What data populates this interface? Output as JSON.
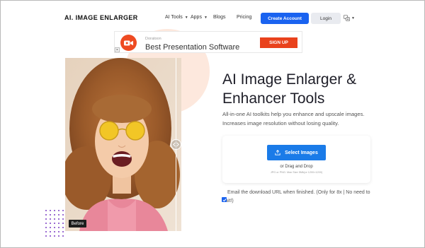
{
  "header": {
    "brand": "AI. IMAGE ENLARGER",
    "nav": [
      {
        "label": "AI Tools",
        "has_dropdown": true
      },
      {
        "label": "Apps",
        "has_dropdown": true
      },
      {
        "label": "Blogs",
        "has_dropdown": false
      },
      {
        "label": "Pricing",
        "has_dropdown": false
      }
    ],
    "create_account": "Create Account",
    "login": "Login",
    "language_icon": "translate-icon"
  },
  "ad": {
    "sponsor": "Doratoon",
    "title": "Best Presentation Software",
    "cta": "SIGN UP",
    "logo_icon": "video-camera-icon"
  },
  "preview": {
    "before_label": "Before",
    "handle_icon": "compare-arrows-icon"
  },
  "hero": {
    "title_line1": "AI Image Enlarger &",
    "title_line2": "Enhancer Tools",
    "description": "All-in-one AI toolkits help you enhance and upscale images. Increases image resolution without losing quality."
  },
  "upload": {
    "button": "Select Images",
    "button_icon": "upload-icon",
    "drag_text": "or Drag and Drop",
    "hint": "JPG or PNG. Max Size 5Mb(or 1200×1200)"
  },
  "email_option": {
    "label": "Email the download URL when finished. (Only for 8x | No need to wait!)",
    "checked": true
  },
  "colors": {
    "primary": "#1a63f0",
    "upload_button": "#1a7be8",
    "ad_orange": "#e9421c",
    "deco_circle": "#fde8dd",
    "dots": "#7b3fc4"
  }
}
